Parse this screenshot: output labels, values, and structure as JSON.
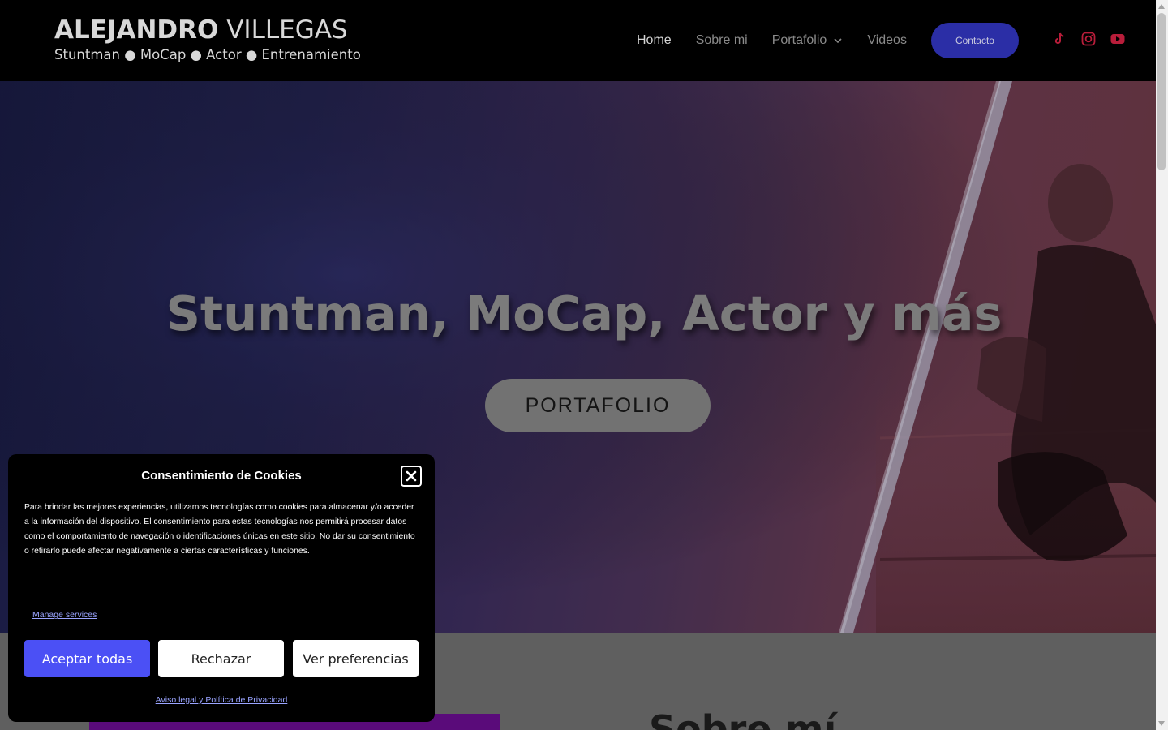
{
  "header": {
    "logo": {
      "name_bold": "ALEJANDRO",
      "name_light": "VILLEGAS",
      "tagline": "Stuntman ● MoCap ● Actor ● Entrenamiento"
    },
    "nav": {
      "home": "Home",
      "about": "Sobre mi",
      "portfolio": "Portafolio",
      "videos": "Videos",
      "contact": "Contacto"
    },
    "social_icons": [
      "tiktok-icon",
      "instagram-icon",
      "youtube-icon"
    ],
    "social_color": "#b81d3a"
  },
  "hero": {
    "title": "Stuntman, MoCap, Actor y más",
    "button": "PORTAFOLIO"
  },
  "about": {
    "title": "Sobre mí"
  },
  "cookie_banner": {
    "title": "Consentimiento de Cookies",
    "body": "Para brindar las mejores experiencias, utilizamos tecnologías como cookies para almacenar y/o acceder a la información del dispositivo. El consentimiento para estas tecnologías nos permitirá procesar datos como el comportamiento de navegación o identificaciones únicas en este sitio. No dar su consentimiento o retirarlo puede afectar negativamente a ciertas características y funciones.",
    "manage_link": "Manage services",
    "accept": "Aceptar todas",
    "reject": "Rechazar",
    "preferences": "Ver preferencias",
    "legal_link": "Aviso legal y Política de Privacidad",
    "accent_color": "#4b50f5"
  }
}
